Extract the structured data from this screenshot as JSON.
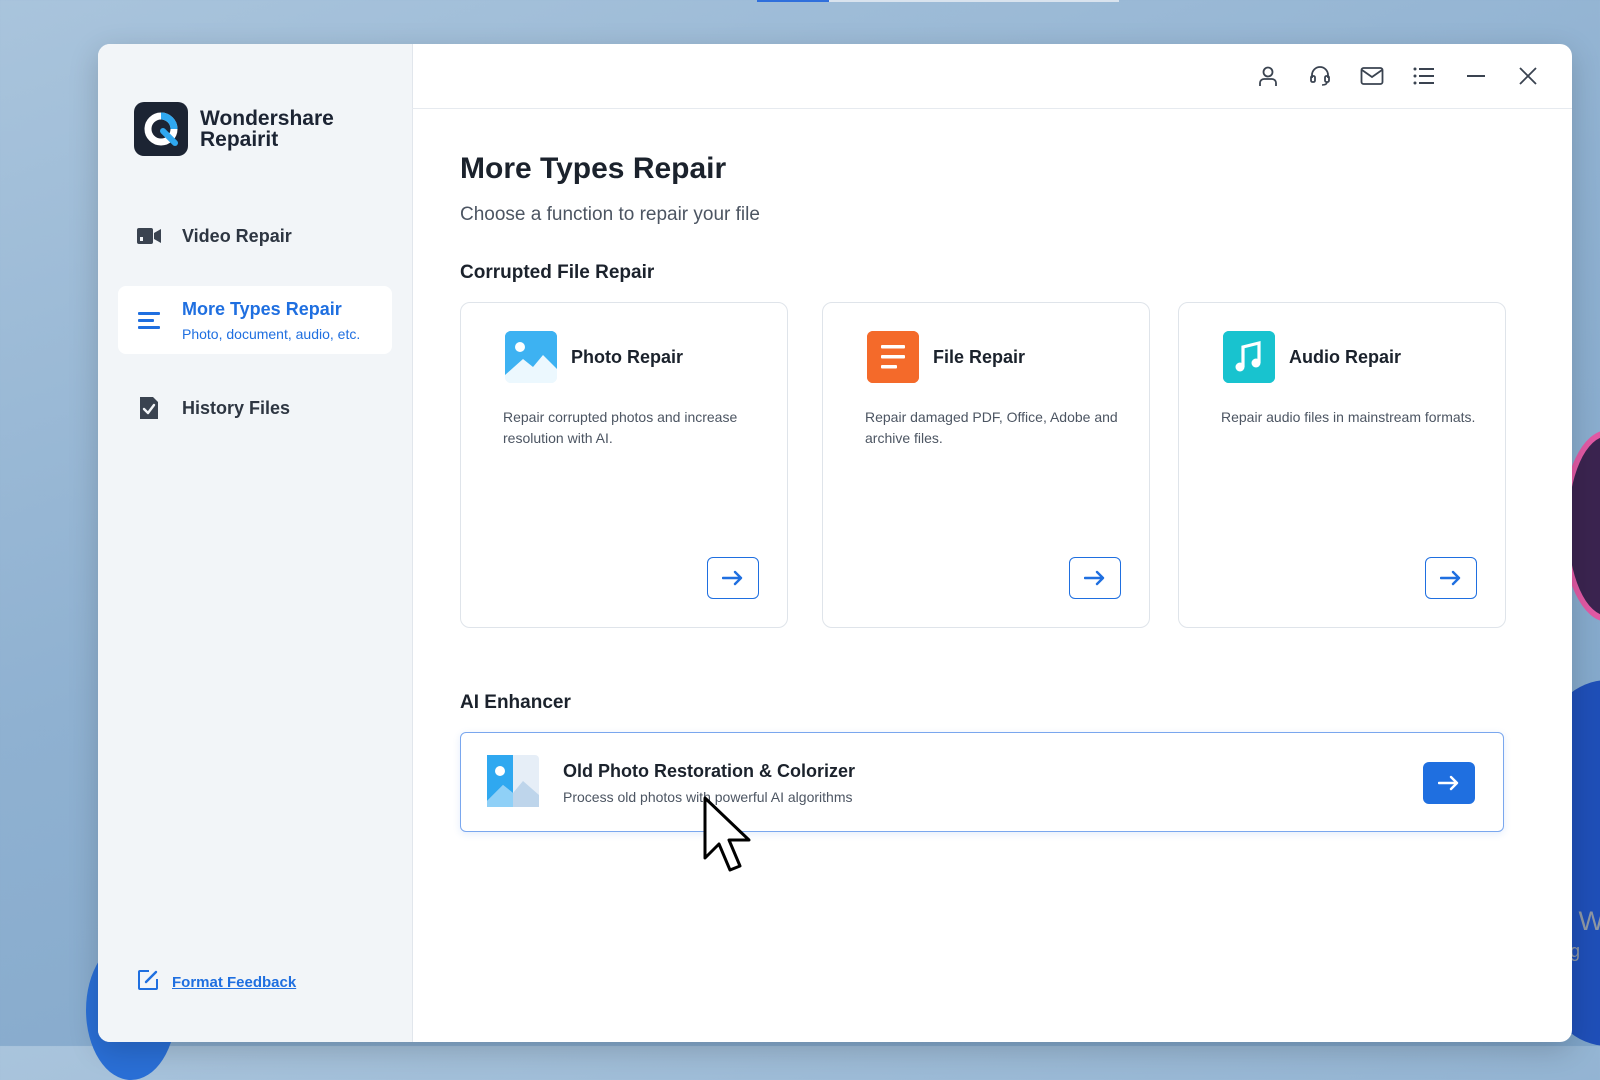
{
  "app": {
    "brand_line1": "Wondershare",
    "brand_line2": "Repairit"
  },
  "sidebar": {
    "items": [
      {
        "label": "Video Repair",
        "icon": "video-camera-icon"
      },
      {
        "label": "More Types Repair",
        "sublabel": "Photo, document, audio, etc.",
        "icon": "list-icon",
        "active": true
      },
      {
        "label": "History Files",
        "icon": "file-check-icon"
      }
    ],
    "feedback_label": "Format Feedback"
  },
  "topbar": {
    "icons": [
      "user-icon",
      "headset-icon",
      "mail-icon",
      "menu-list-icon",
      "minimize-icon",
      "close-icon"
    ]
  },
  "main": {
    "title": "More Types Repair",
    "subtitle": "Choose a function to repair your file",
    "sections": {
      "corrupted": {
        "title": "Corrupted File Repair",
        "cards": [
          {
            "title": "Photo Repair",
            "desc": "Repair corrupted photos and increase resolution with AI.",
            "icon": "photo-icon"
          },
          {
            "title": "File Repair",
            "desc": "Repair damaged PDF, Office, Adobe and archive files.",
            "icon": "document-icon"
          },
          {
            "title": "Audio Repair",
            "desc": "Repair audio files in mainstream formats.",
            "icon": "music-note-icon"
          }
        ]
      },
      "ai": {
        "title": "AI Enhancer",
        "card": {
          "title": "Old Photo Restoration & Colorizer",
          "desc": "Process old photos with powerful AI algorithms",
          "icon": "photo-colorizer-icon"
        }
      }
    }
  },
  "desktop": {
    "watermark_line1": "Activate W",
    "watermark_line2": "Go to Setting"
  },
  "colors": {
    "accent": "#1f6fe0",
    "photo": "#2fa8f0",
    "file": "#f46a2a",
    "audio": "#18c3cf",
    "sidebar_bg": "#f2f5f8"
  }
}
